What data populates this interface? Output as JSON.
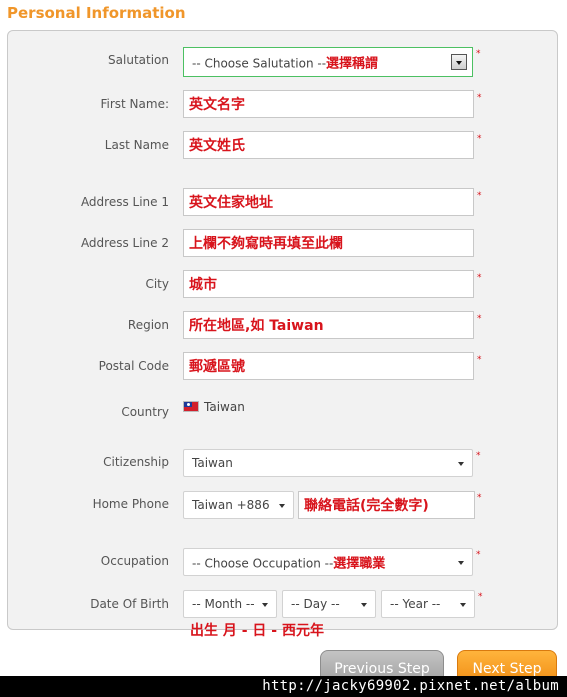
{
  "section_title": "Personal Information",
  "required_marker": "*",
  "form": {
    "salutation": {
      "label": "Salutation",
      "value": "-- Choose Salutation --",
      "hint": "選擇稱謂"
    },
    "first_name": {
      "label": "First Name:",
      "value": "英文名字"
    },
    "last_name": {
      "label": "Last Name",
      "value": "英文姓氏"
    },
    "address1": {
      "label": "Address Line 1",
      "value": "英文住家地址"
    },
    "address2": {
      "label": "Address Line 2",
      "value": "上欄不夠寫時再填至此欄"
    },
    "city": {
      "label": "City",
      "value": "城市"
    },
    "region": {
      "label": "Region",
      "value": "所在地區,如 Taiwan"
    },
    "postal_code": {
      "label": "Postal Code",
      "value": "郵遞區號"
    },
    "country": {
      "label": "Country",
      "value": "Taiwan",
      "flag_icon": "taiwan-flag-icon"
    },
    "citizenship": {
      "label": "Citizenship",
      "value": "Taiwan"
    },
    "home_phone": {
      "label": "Home Phone",
      "country_code": "Taiwan +886",
      "value": "聯絡電話(完全數字)"
    },
    "occupation": {
      "label": "Occupation",
      "value": "-- Choose Occupation --",
      "hint": "選擇職業"
    },
    "dob": {
      "label": "Date Of Birth",
      "month": "-- Month --",
      "day": "-- Day --",
      "year": "-- Year --",
      "hint": "出生 月 - 日 - 西元年"
    }
  },
  "buttons": {
    "previous": "Previous Step",
    "next": "Next Step"
  },
  "watermark": "http://jacky69902.pixnet.net/album",
  "colors": {
    "accent": "#f0962a",
    "required": "#d8141c",
    "focus_border": "#4cc062"
  }
}
